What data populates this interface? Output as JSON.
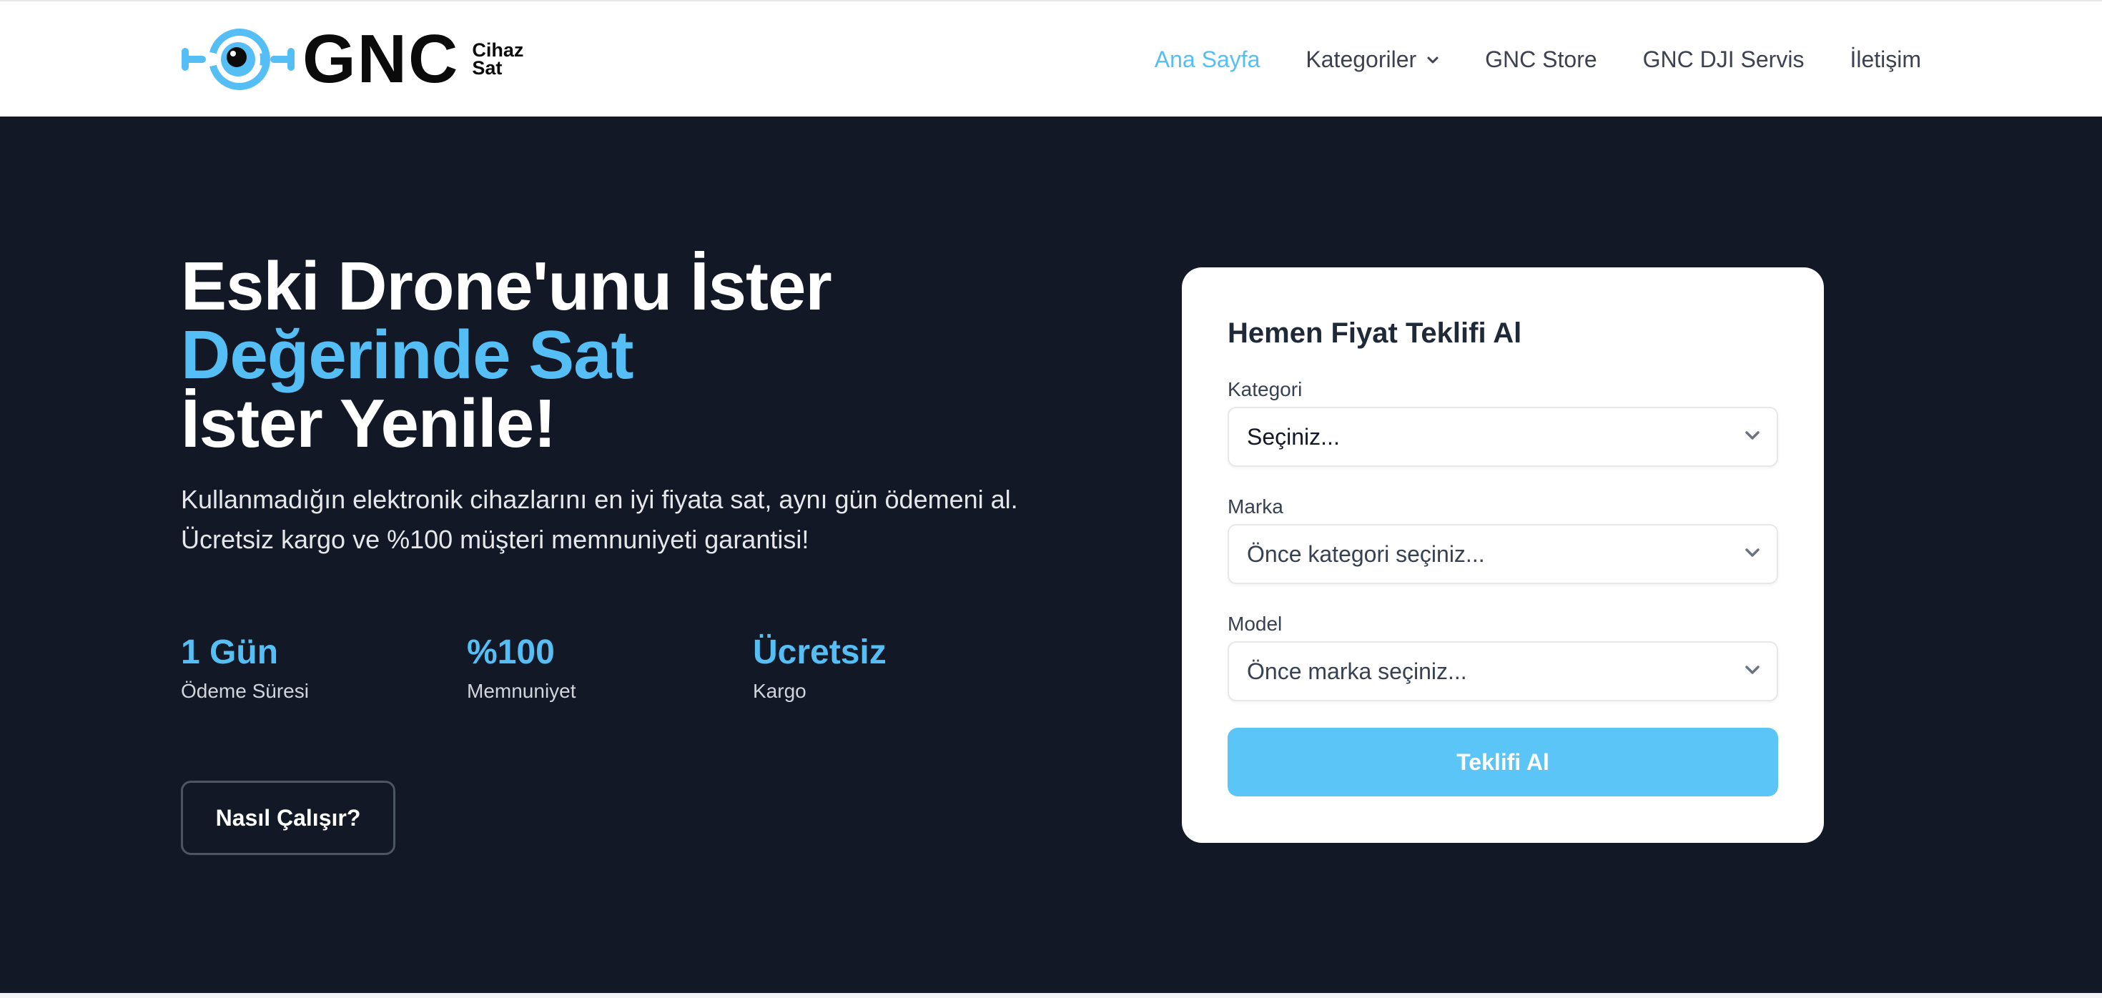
{
  "header": {
    "logo": {
      "brand": "GNC",
      "sub_line1": "Cihaz",
      "sub_line2": "Sat",
      "icon": "eye-drone-logo-icon"
    },
    "nav": [
      {
        "label": "Ana Sayfa",
        "active": true
      },
      {
        "label": "Kategoriler",
        "has_dropdown": true
      },
      {
        "label": "GNC Store"
      },
      {
        "label": "GNC DJI Servis"
      },
      {
        "label": "İletişim"
      }
    ]
  },
  "hero": {
    "headline": {
      "line1": "Eski Drone'unu İster",
      "line2": "Değerinde Sat",
      "line3": "İster Yenile!"
    },
    "subtext": {
      "line1": "Kullanmadığın elektronik cihazlarını en iyi fiyata sat, aynı gün ödemeni al.",
      "line2": "Ücretsiz kargo ve %100 müşteri memnuniyeti garantisi!"
    },
    "stats": [
      {
        "value": "1 Gün",
        "label": "Ödeme Süresi"
      },
      {
        "value": "%100",
        "label": "Memnuniyet"
      },
      {
        "value": "Ücretsiz",
        "label": "Kargo"
      }
    ],
    "how_button": "Nasıl Çalışır?"
  },
  "form": {
    "title": "Hemen Fiyat Teklifi Al",
    "category": {
      "label": "Kategori",
      "value": "Seçiniz..."
    },
    "brand": {
      "label": "Marka",
      "value": "Önce kategori seçiniz..."
    },
    "model": {
      "label": "Model",
      "value": "Önce marka seçiniz..."
    },
    "submit": "Teklifi Al"
  },
  "colors": {
    "accent": "#55bff5",
    "hero_bg": "#121826",
    "button_bg": "#5cc5f8"
  }
}
